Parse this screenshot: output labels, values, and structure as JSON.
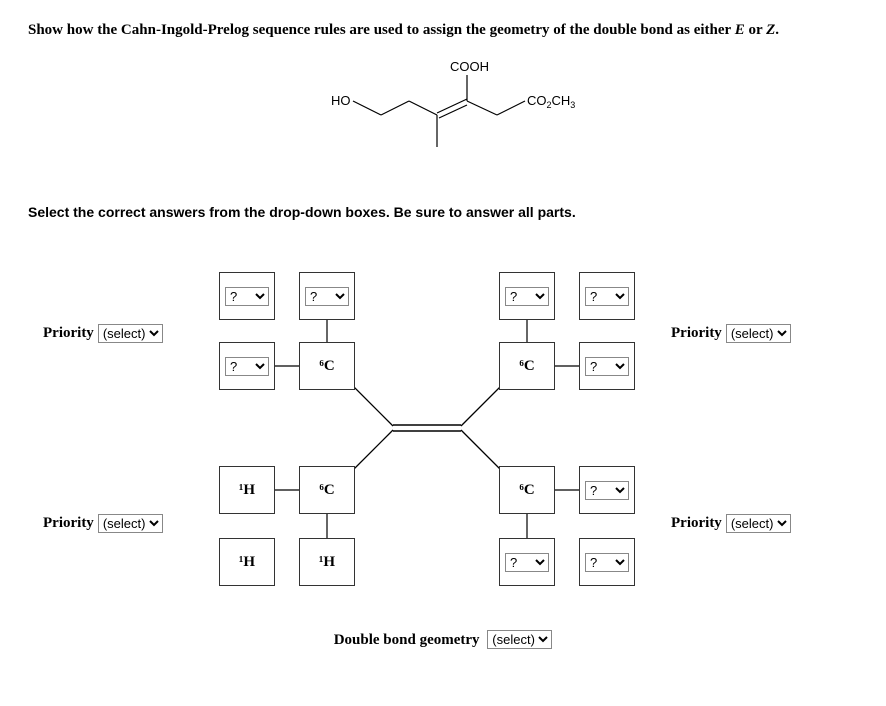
{
  "question_prefix": "Show how the Cahn-Ingold-Prelog sequence rules are used to assign the geometry of the double bond as either ",
  "e_label": "E",
  "or_text": " or ",
  "z_label": "Z",
  "period": ".",
  "structure_labels": {
    "cooh": "COOH",
    "ho": "HO",
    "co2ch3_prefix": "CO",
    "co2ch3_sub": "2",
    "co2ch3_suffix": "CH",
    "co2ch3_sub2": "3"
  },
  "instruction": "Select the correct answers from the drop-down boxes. Be sure to answer all parts.",
  "priority_label": "Priority",
  "static_boxes": {
    "c6_tl": "⁶C",
    "c6_tr": "⁶C",
    "c6_bl": "⁶C",
    "c6_br": "⁶C",
    "h1_bl_left": "¹H",
    "h1_bl_bot": "¹H",
    "h1_blc_bot": "¹H"
  },
  "dropdown_placeholder": "?",
  "select_placeholder": "(select)",
  "geometry_label": "Double bond geometry"
}
